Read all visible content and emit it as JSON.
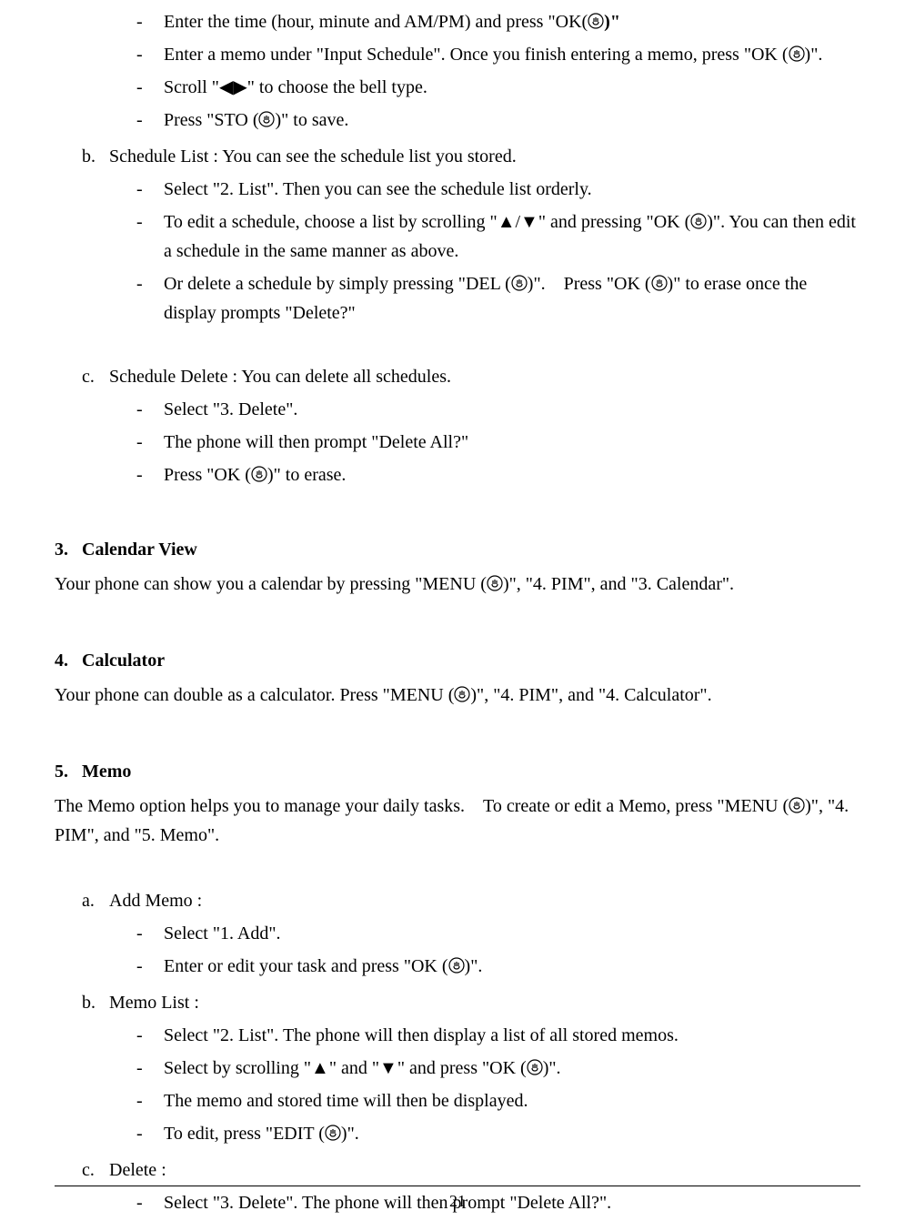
{
  "sym": {
    "left": "◀",
    "right": "▶",
    "up": "▲",
    "down": "▼",
    "dash": "-"
  },
  "topDashes": {
    "d1a": "Enter the time (hour, minute and AM/PM) and press \"OK(",
    "d1b": ")\"",
    "d2a": "Enter a memo under \"Input Schedule\". Once you finish entering a memo, press \"OK (",
    "d2b": ")\".",
    "d3a": "Scroll \"",
    "d3b": "\" to choose the bell type.",
    "d4a": "Press \"STO (",
    "d4b": ")\" to save."
  },
  "b": {
    "letter": "b.",
    "title": "Schedule List : You can see the schedule list you stored.",
    "items": {
      "i1": "Select \"2. List\". Then you can see the schedule list orderly.",
      "i2a": "To edit a schedule, choose a list by scrolling \"",
      "i2mid": "/",
      "i2b": "\" and pressing \"OK (",
      "i2c": ")\". You can then edit a schedule in the same manner as above.",
      "i3a": "Or delete a schedule by simply pressing \"DEL (",
      "i3b": ")\". Press \"OK (",
      "i3c": ")\" to erase once the display prompts \"Delete?\""
    }
  },
  "c": {
    "letter": "c.",
    "title": "Schedule Delete : You can delete all schedules.",
    "items": {
      "i1": "Select \"3. Delete\".",
      "i2": "The phone will then prompt \"Delete All?\"",
      "i3a": "Press \"OK (",
      "i3b": ")\" to erase."
    }
  },
  "sec3": {
    "num": "3.",
    "title": "Calendar View",
    "body_a": "Your phone can show you a calendar by pressing \"MENU (",
    "body_b": ")\", \"4. PIM\", and \"3. Calendar\"."
  },
  "sec4": {
    "num": "4.",
    "title": "Calculator",
    "body_a": "Your phone can double as a calculator. Press \"MENU (",
    "body_b": ")\", \"4. PIM\", and \"4. Calculator\"."
  },
  "sec5": {
    "num": "5.",
    "title": "Memo",
    "body_a": "The Memo option helps you to manage your daily tasks. To create or edit a Memo, press \"MENU (",
    "body_b": ")\", \"4. PIM\", and \"5. Memo\"."
  },
  "memo_a": {
    "letter": "a.",
    "title": "Add Memo :",
    "items": {
      "i1": "Select \"1. Add\".",
      "i2a": "Enter or edit your task and press \"OK (",
      "i2b": ")\"."
    }
  },
  "memo_b": {
    "letter": "b.",
    "title": "Memo List :",
    "items": {
      "i1": "Select \"2. List\". The phone will then display a list of all stored memos.",
      "i2a": "Select by scrolling \"",
      "i2b": "\" and \"",
      "i2c": "\" and press \"OK (",
      "i2d": ")\".",
      "i3": "The memo and stored time will then be displayed.",
      "i4a": "To edit, press \"EDIT (",
      "i4b": ")\"."
    }
  },
  "memo_c": {
    "letter": "c.",
    "title": "Delete :",
    "items": {
      "i1": "Select \"3. Delete\". The phone will then prompt \"Delete All?\"."
    }
  },
  "pageNumber": "21"
}
